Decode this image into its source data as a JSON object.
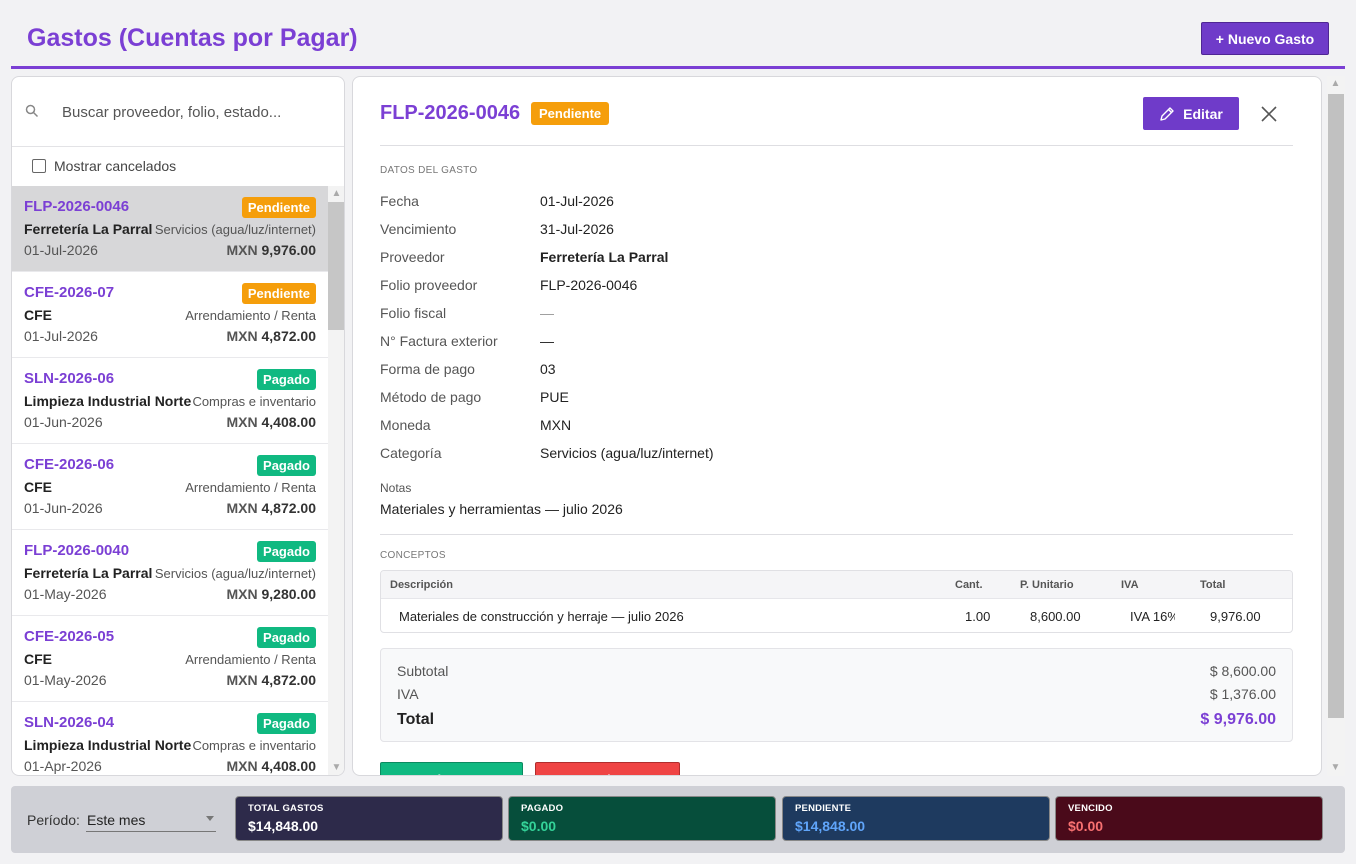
{
  "header": {
    "title": "Gastos (Cuentas por Pagar)",
    "new_button": "+ Nuevo Gasto"
  },
  "search": {
    "placeholder": "Buscar proveedor, folio, estado..."
  },
  "filter": {
    "show_cancelled_label": "Mostrar cancelados",
    "show_cancelled_checked": false
  },
  "list": [
    {
      "folio": "FLP-2026-0046",
      "status": "Pendiente",
      "vendor": "Ferretería La Parral",
      "category": "Servicios (agua/luz/internet)",
      "date": "01-Jul-2026",
      "currency": "MXN",
      "amount": "9,976.00",
      "selected": true
    },
    {
      "folio": "CFE-2026-07",
      "status": "Pendiente",
      "vendor": "CFE",
      "category": "Arrendamiento / Renta",
      "date": "01-Jul-2026",
      "currency": "MXN",
      "amount": "4,872.00"
    },
    {
      "folio": "SLN-2026-06",
      "status": "Pagado",
      "vendor": "Limpieza Industrial Norte",
      "category": "Compras e inventario",
      "date": "01-Jun-2026",
      "currency": "MXN",
      "amount": "4,408.00"
    },
    {
      "folio": "CFE-2026-06",
      "status": "Pagado",
      "vendor": "CFE",
      "category": "Arrendamiento / Renta",
      "date": "01-Jun-2026",
      "currency": "MXN",
      "amount": "4,872.00"
    },
    {
      "folio": "FLP-2026-0040",
      "status": "Pagado",
      "vendor": "Ferretería La Parral",
      "category": "Servicios (agua/luz/internet)",
      "date": "01-May-2026",
      "currency": "MXN",
      "amount": "9,280.00"
    },
    {
      "folio": "CFE-2026-05",
      "status": "Pagado",
      "vendor": "CFE",
      "category": "Arrendamiento / Renta",
      "date": "01-May-2026",
      "currency": "MXN",
      "amount": "4,872.00"
    },
    {
      "folio": "SLN-2026-04",
      "status": "Pagado",
      "vendor": "Limpieza Industrial Norte",
      "category": "Compras e inventario",
      "date": "01-Apr-2026",
      "currency": "MXN",
      "amount": "4,408.00"
    }
  ],
  "detail": {
    "folio": "FLP-2026-0046",
    "status": "Pendiente",
    "edit_button": "Editar",
    "section_data": "DATOS DEL GASTO",
    "fields": [
      {
        "label": "Fecha",
        "value": "01-Jul-2026"
      },
      {
        "label": "Vencimiento",
        "value": "31-Jul-2026"
      },
      {
        "label": "Proveedor",
        "value": "Ferretería La Parral"
      },
      {
        "label": "Folio proveedor",
        "value": "FLP-2026-0046"
      },
      {
        "label": "Folio fiscal",
        "value": "—"
      },
      {
        "label": "N° Factura exterior",
        "value": "—"
      },
      {
        "label": "Forma de pago",
        "value": "03"
      },
      {
        "label": "Método de pago",
        "value": "PUE"
      },
      {
        "label": "Moneda",
        "value": "MXN"
      },
      {
        "label": "Categoría",
        "value": "Servicios (agua/luz/internet)"
      }
    ],
    "notes_label": "Notas",
    "notes": "Materiales y herramientas — julio 2026",
    "section_concepts": "CONCEPTOS",
    "concepts_headers": {
      "desc": "Descripción",
      "qty": "Cant.",
      "unit": "P. Unitario",
      "iva": "IVA",
      "total": "Total"
    },
    "concepts": [
      {
        "desc": "Materiales de construcción y herraje — julio 2026",
        "qty": "1.00",
        "unit": "8,600.00",
        "iva": "IVA 16%",
        "total": "9,976.00"
      }
    ],
    "subtotal_label": "Subtotal",
    "subtotal": "$ 8,600.00",
    "iva_label": "IVA",
    "iva": "$ 1,376.00",
    "total_label": "Total",
    "total": "$ 9,976.00",
    "pay_button": "✓ Registrar pago",
    "cancel_button": "✕ Cancelar gasto"
  },
  "footer": {
    "period_label": "Período:",
    "period_value": "Este mes",
    "kpis": [
      {
        "label": "TOTAL GASTOS",
        "value": "$14,848.00",
        "bg": "#2d2a4a",
        "color": "#ffffff"
      },
      {
        "label": "PAGADO",
        "value": "$0.00",
        "bg": "#064e3b",
        "color": "#34d399"
      },
      {
        "label": "PENDIENTE",
        "value": "$14,848.00",
        "bg": "#1e3a5f",
        "color": "#60a5fa"
      },
      {
        "label": "VENCIDO",
        "value": "$0.00",
        "bg": "#4a0a1a",
        "color": "#f87171"
      }
    ]
  },
  "colors": {
    "accent": "#7b3fd4",
    "pending": "#f59e0b",
    "paid": "#10b981",
    "danger": "#ef4444"
  }
}
